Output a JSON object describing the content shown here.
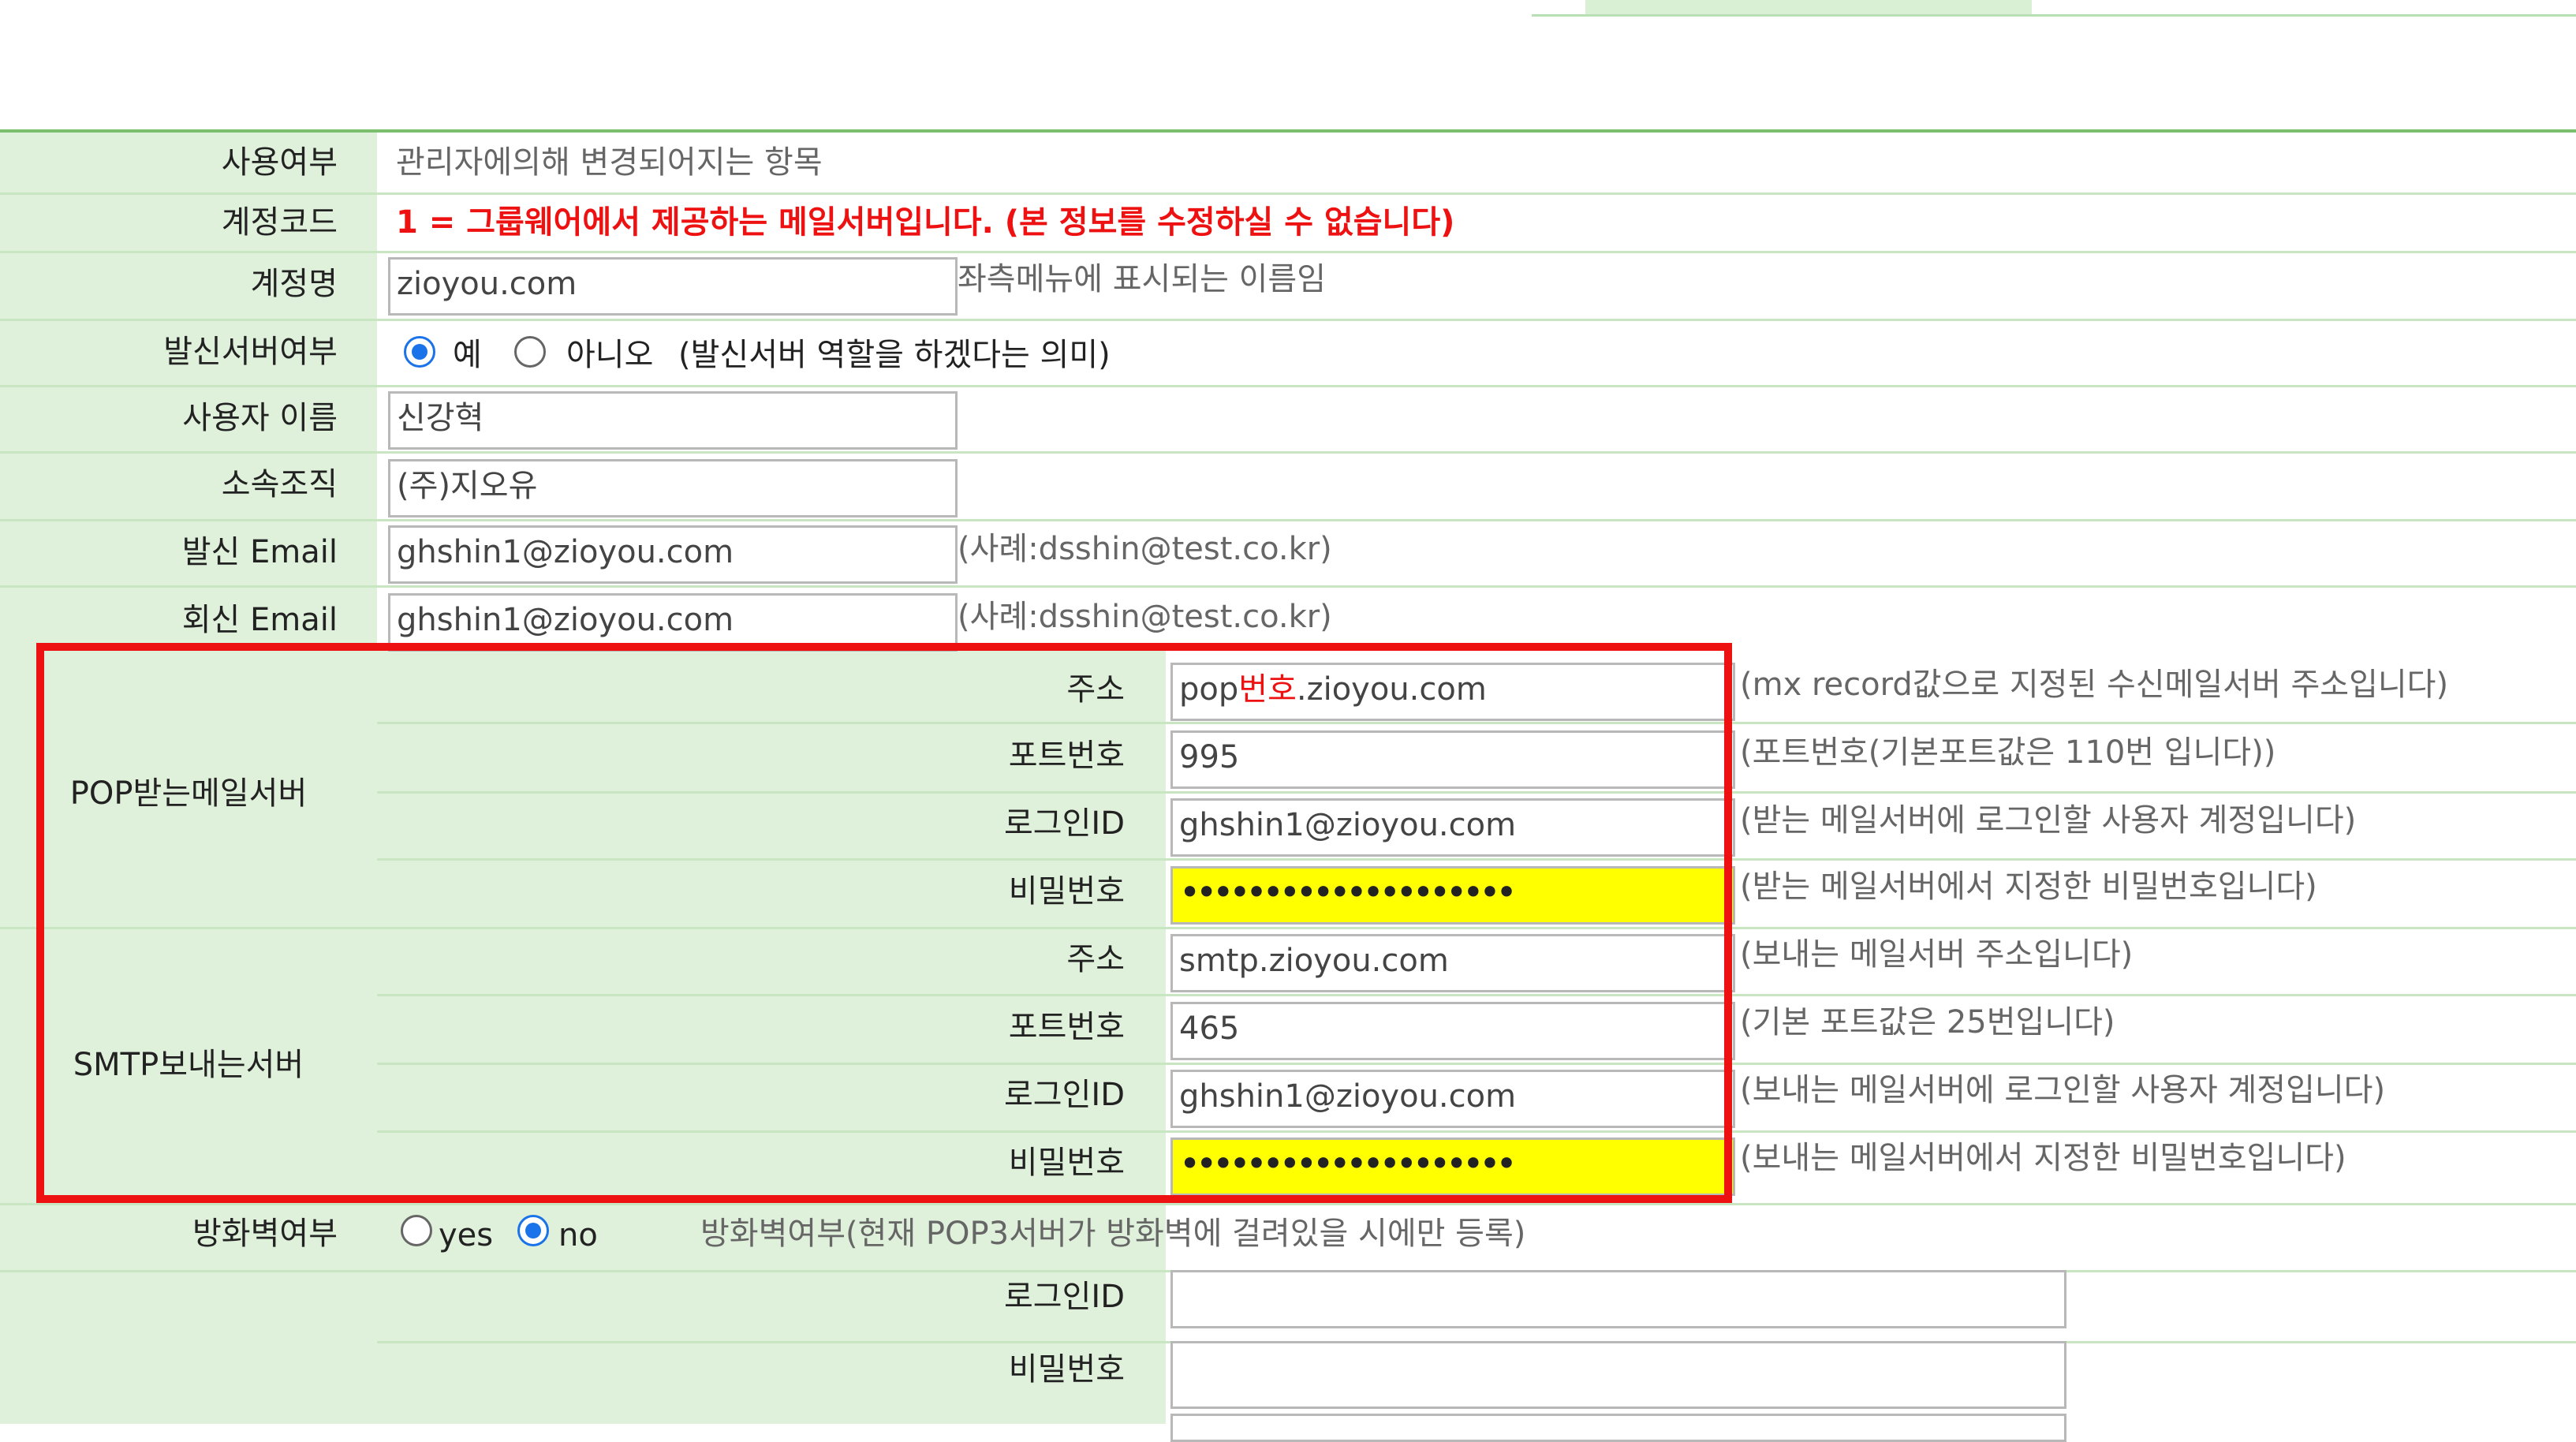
{
  "rows": {
    "usage": {
      "label": "사용여부",
      "value": "관리자에의해 변경되어지는 항목"
    },
    "account_code": {
      "label": "계정코드",
      "notice": "1 = 그룹웨어에서 제공하는 메일서버입니다. (본 정보를 수정하실 수 없습니다)"
    },
    "account_name": {
      "label": "계정명",
      "value": "zioyou.com",
      "hint": "좌측메뉴에 표시되는 이름임"
    },
    "outgoing_server": {
      "label": "발신서버여부",
      "option_yes": "예",
      "option_no": "아니오",
      "hint": "(발신서버 역할을 하겠다는 의미)",
      "selected": "yes"
    },
    "user_name": {
      "label": "사용자 이름",
      "value": "신강혁"
    },
    "organization": {
      "label": "소속조직",
      "value": "(주)지오유"
    },
    "sender_email": {
      "label": "발신 Email",
      "value": "ghshin1@zioyou.com",
      "hint": "(사례:dsshin@test.co.kr)"
    },
    "reply_email": {
      "label": "회신 Email",
      "value": "ghshin1@zioyou.com",
      "hint": "(사례:dsshin@test.co.kr)"
    }
  },
  "pop": {
    "group_label": "POP받는메일서버",
    "address": {
      "label": "주소",
      "value_prefix": "pop",
      "value_red": "번호",
      "value_suffix": ".zioyou.com",
      "hint": "(mx record값으로 지정된 수신메일서버 주소입니다)"
    },
    "port": {
      "label": "포트번호",
      "value": "995",
      "hint": "(포트번호(기본포트값은 110번 입니다))"
    },
    "login": {
      "label": "로그인ID",
      "value": "ghshin1@zioyou.com",
      "hint": "(받는 메일서버에 로그인할 사용자 계정입니다)"
    },
    "password": {
      "label": "비밀번호",
      "value": "••••••••••••••••••••",
      "hint": "(받는 메일서버에서 지정한 비밀번호입니다)"
    }
  },
  "smtp": {
    "group_label": "SMTP보내는서버",
    "address": {
      "label": "주소",
      "value": "smtp.zioyou.com",
      "hint": "(보내는 메일서버 주소입니다)"
    },
    "port": {
      "label": "포트번호",
      "value": "465",
      "hint": "(기본 포트값은 25번입니다)"
    },
    "login": {
      "label": "로그인ID",
      "value": "ghshin1@zioyou.com",
      "hint": "(보내는 메일서버에 로그인할 사용자 계정입니다)"
    },
    "password": {
      "label": "비밀번호",
      "value": "••••••••••••••••••••",
      "hint": "(보내는 메일서버에서 지정한 비밀번호입니다)"
    }
  },
  "firewall": {
    "label": "방화벽여부",
    "option_yes": "yes",
    "option_no": "no",
    "selected": "no",
    "hint": "방화벽여부(현재 POP3서버가 방화벽에 걸려있을 시에만 등록)",
    "login_label": "로그인ID",
    "login_value": "",
    "password_label": "비밀번호",
    "password_value": ""
  },
  "colors": {
    "label_bg": "#dff1db",
    "highlight_box": "#ee1111",
    "password_bg": "#ffff00",
    "radio_selected": "#1a73e8"
  }
}
